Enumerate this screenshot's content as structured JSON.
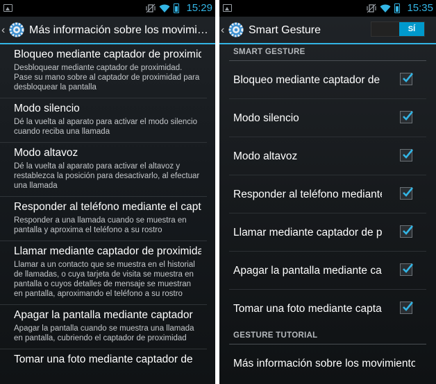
{
  "left_screen": {
    "status": {
      "time": "15:29"
    },
    "title": "Más información sobre los movimientos",
    "items": [
      {
        "title": "Bloqueo mediante captador de proximidad",
        "summary": "Desbloquear mediante captador de proximidad. Pase su mano sobre al captador de proximidad para desbloquear la pantalla"
      },
      {
        "title": "Modo silencio",
        "summary": "Dé la vuelta al aparato para activar el modo silencio cuando reciba una llamada"
      },
      {
        "title": "Modo altavoz",
        "summary": "Dé la vuelta al aparato para activar el altavoz y restablezca la posición para desactivarlo, al efectuar una llamada"
      },
      {
        "title": "Responder al teléfono mediante el captador",
        "summary": "Responder a una llamada cuando se muestra en pantalla y aproxima el teléfono a su rostro"
      },
      {
        "title": "Llamar mediante captador de proximidad",
        "summary": "Llamar a un contacto que se muestra en el historial de llamadas, o cuya tarjeta de visita se muestra en pantalla o cuyos detalles de mensaje se muestran en pantalla, aproximando el teléfono a su rostro"
      },
      {
        "title": "Apagar la pantalla mediante captador",
        "summary": "Apagar la pantalla cuando se muestra una llamada en pantalla, cubriendo el captador de proximidad"
      },
      {
        "title": "Tomar una foto mediante captador de",
        "summary": ""
      }
    ]
  },
  "right_screen": {
    "status": {
      "time": "15:35"
    },
    "title": "Smart Gesture",
    "toggle_label": "SÍ",
    "section_smart": "SMART GESTURE",
    "items": [
      {
        "label": "Bloqueo mediante captador de proximidad",
        "checked": true
      },
      {
        "label": "Modo silencio",
        "checked": true
      },
      {
        "label": "Modo altavoz",
        "checked": true
      },
      {
        "label": "Responder al teléfono mediante el captador",
        "checked": true
      },
      {
        "label": "Llamar mediante captador de proximidad",
        "checked": true
      },
      {
        "label": "Apagar la pantalla mediante captador",
        "checked": true
      },
      {
        "label": "Tomar una foto mediante captador",
        "checked": true
      }
    ],
    "section_tutorial": "GESTURE TUTORIAL",
    "tutorial_item": "Más información sobre los movimientos"
  },
  "colors": {
    "accent": "#33b5e5",
    "toggle_on": "#0099cc",
    "background": "#1b1f22"
  },
  "icons": [
    "image-notification-icon",
    "vibrate-icon",
    "wifi-icon",
    "battery-icon",
    "back-chevron-icon",
    "settings-gear-icon",
    "checkmark-icon"
  ]
}
